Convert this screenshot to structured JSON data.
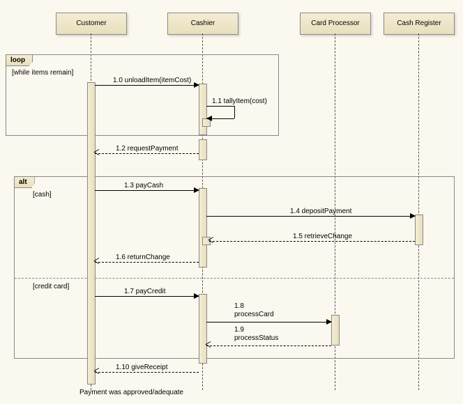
{
  "lifelines": {
    "customer": "Customer",
    "cashier": "Cashier",
    "cardproc": "Card Processor",
    "register": "Cash Register"
  },
  "frames": {
    "loop": {
      "label": "loop",
      "guard": "[while items remain]"
    },
    "alt": {
      "label": "alt",
      "guard1": "[cash]",
      "guard2": "[credit card]"
    }
  },
  "messages": {
    "m10": "1.0 unloadItem(itemCost)",
    "m11": "1.1 tallyItem(cost)",
    "m12": "1.2 requestPayment",
    "m13": "1.3 payCash",
    "m14": "1.4 depositPayment",
    "m15": "1.5 retrieveChange",
    "m16": "1.6 returnChange",
    "m17": "1.7 payCredit",
    "m18": "1.8",
    "m18b": "processCard",
    "m19": "1.9",
    "m19b": "processStatus",
    "m110": "1.10 giveReceipt"
  },
  "note": "Payment was approved/adequate",
  "chart_data": {
    "type": "sequence-diagram",
    "lifelines": [
      "Customer",
      "Cashier",
      "Card Processor",
      "Cash Register"
    ],
    "fragments": [
      {
        "type": "loop",
        "guard": "while items remain",
        "messages": [
          {
            "num": "1.0",
            "from": "Customer",
            "to": "Cashier",
            "label": "unloadItem(itemCost)",
            "kind": "sync"
          },
          {
            "num": "1.1",
            "from": "Cashier",
            "to": "Cashier",
            "label": "tallyItem(cost)",
            "kind": "self"
          }
        ]
      },
      {
        "num": "1.2",
        "from": "Cashier",
        "to": "Customer",
        "label": "requestPayment",
        "kind": "return"
      },
      {
        "type": "alt",
        "operands": [
          {
            "guard": "cash",
            "messages": [
              {
                "num": "1.3",
                "from": "Customer",
                "to": "Cashier",
                "label": "payCash",
                "kind": "sync"
              },
              {
                "num": "1.4",
                "from": "Cashier",
                "to": "Cash Register",
                "label": "depositPayment",
                "kind": "sync"
              },
              {
                "num": "1.5",
                "from": "Cash Register",
                "to": "Cashier",
                "label": "retrieveChange",
                "kind": "return"
              },
              {
                "num": "1.6",
                "from": "Cashier",
                "to": "Customer",
                "label": "returnChange",
                "kind": "return"
              }
            ]
          },
          {
            "guard": "credit card",
            "messages": [
              {
                "num": "1.7",
                "from": "Customer",
                "to": "Cashier",
                "label": "payCredit",
                "kind": "sync"
              },
              {
                "num": "1.8",
                "from": "Cashier",
                "to": "Card Processor",
                "label": "processCard",
                "kind": "sync"
              },
              {
                "num": "1.9",
                "from": "Card Processor",
                "to": "Cashier",
                "label": "processStatus",
                "kind": "return"
              }
            ]
          }
        ]
      },
      {
        "num": "1.10",
        "from": "Cashier",
        "to": "Customer",
        "label": "giveReceipt",
        "kind": "return",
        "note": "Payment was approved/adequate"
      }
    ]
  }
}
